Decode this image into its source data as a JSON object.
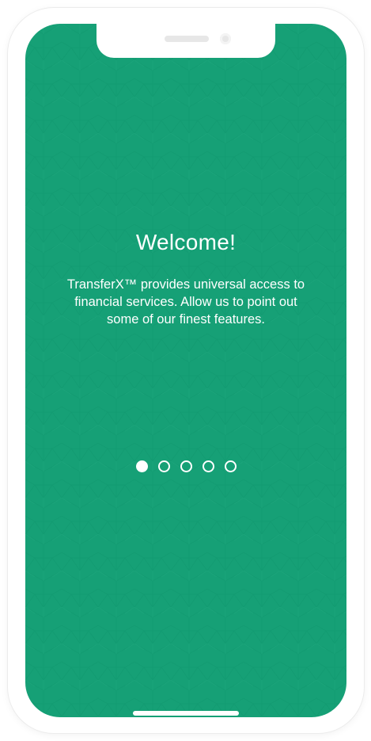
{
  "onboarding": {
    "title": "Welcome!",
    "description": "TransferX™ provides universal access to financial services. Allow us to point out some of our finest features.",
    "page_count": 5,
    "active_page": 1
  },
  "colors": {
    "background": "#16a076",
    "text": "#ffffff"
  }
}
